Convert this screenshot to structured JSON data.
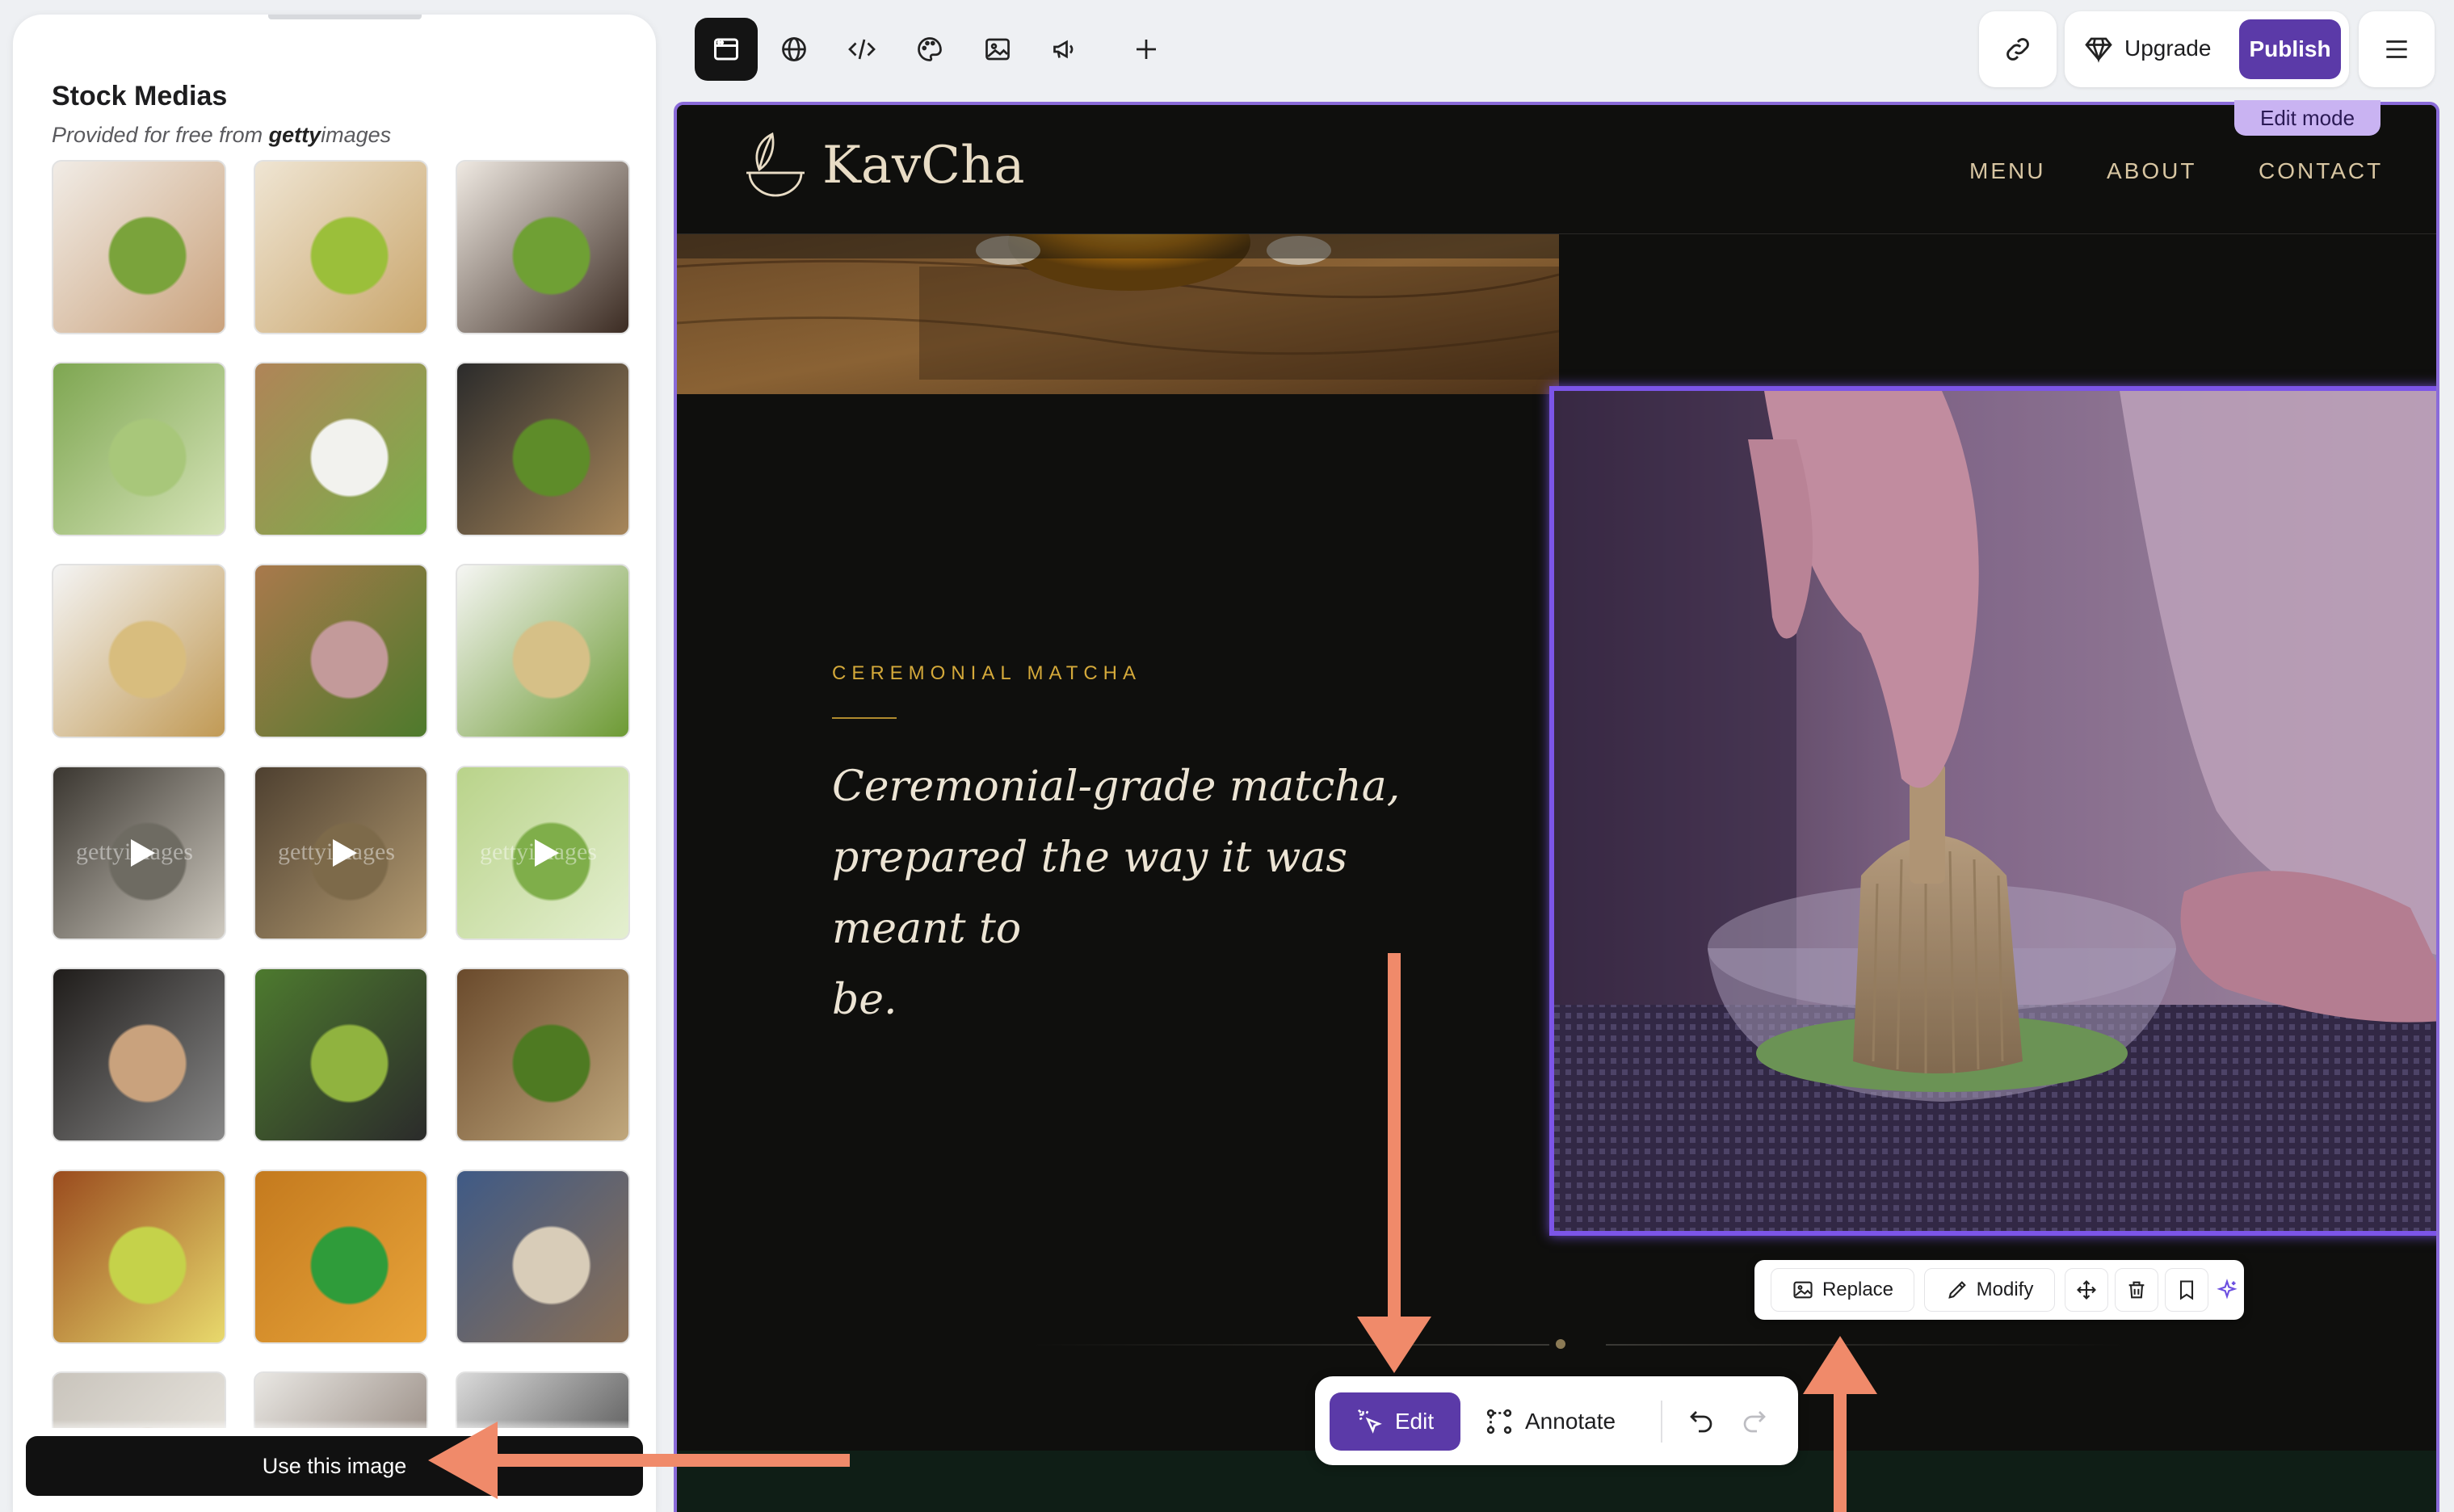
{
  "panel": {
    "title": "Stock Medias",
    "subtitle_prefix": "Provided for free from ",
    "subtitle_brand_bold": "getty",
    "subtitle_brand_rest": "images",
    "video_watermark": "gettyimages",
    "use_button": "Use this image",
    "thumbnails": [
      {
        "name": "hands-whisking-matcha",
        "video": false
      },
      {
        "name": "whisk-in-bowl-on-mat",
        "video": false
      },
      {
        "name": "hands-holding-bowl",
        "video": false
      },
      {
        "name": "whisk-closeup-green",
        "video": false
      },
      {
        "name": "matcha-latte-art",
        "video": false
      },
      {
        "name": "matcha-set-on-tray",
        "video": false
      },
      {
        "name": "hand-holding-whisk",
        "video": false
      },
      {
        "name": "pink-bowl-with-scoop",
        "video": false
      },
      {
        "name": "whisk-and-powder",
        "video": false
      },
      {
        "name": "whisking-video-1",
        "video": true
      },
      {
        "name": "whisking-video-2",
        "video": true
      },
      {
        "name": "whisk-bubbles-video",
        "video": true
      },
      {
        "name": "pouring-water",
        "video": false
      },
      {
        "name": "matcha-flatlay",
        "video": false
      },
      {
        "name": "whisking-in-pitcher",
        "video": false
      },
      {
        "name": "orange-bowl-matcha",
        "video": false
      },
      {
        "name": "green-bowl-whisk",
        "video": false
      },
      {
        "name": "tea-table-setup",
        "video": false
      },
      {
        "name": "cup-with-spout",
        "video": false
      },
      {
        "name": "woman-preparing-tea",
        "video": false
      },
      {
        "name": "overhead-bowl-grey",
        "video": false
      }
    ]
  },
  "toolbar": {
    "tools": [
      "layout-icon",
      "globe-icon",
      "code-icon",
      "palette-icon",
      "image-icon",
      "megaphone-icon",
      "plus-icon"
    ],
    "upgrade_label": "Upgrade",
    "publish_label": "Publish"
  },
  "canvas": {
    "edit_mode_label": "Edit mode",
    "site": {
      "logo_text": "KavCha",
      "nav": [
        "MENU",
        "ABOUT",
        "CONTACT"
      ],
      "eyebrow": "CEREMONIAL MATCHA",
      "headline_lines": [
        "Ceremonial-grade matcha,",
        "prepared the way it was meant to",
        "be."
      ]
    },
    "image_toolbar": {
      "replace_label": "Replace",
      "modify_label": "Modify"
    },
    "action_bar": {
      "edit_label": "Edit",
      "annotate_label": "Annotate"
    }
  },
  "colors": {
    "accent_purple": "#5b3aa8",
    "selection_outline": "#7c55e8",
    "gold": "#d4a93a",
    "arrow": "#f08a6a"
  }
}
